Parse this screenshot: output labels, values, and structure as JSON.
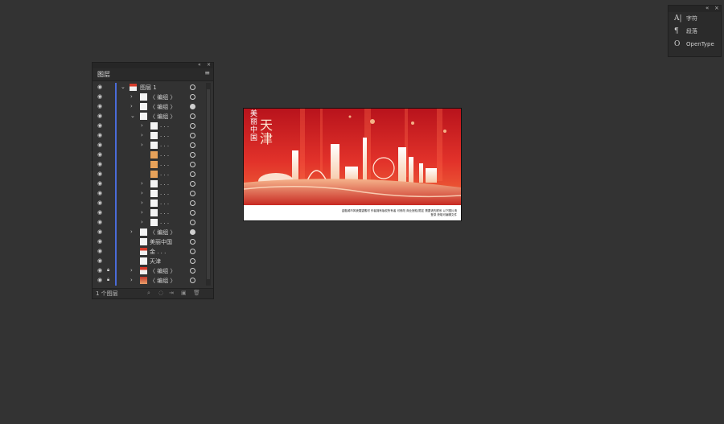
{
  "char_panel": {
    "items": [
      {
        "icon": "A|",
        "label": "字符"
      },
      {
        "icon": "¶",
        "label": "段落"
      },
      {
        "icon": "O",
        "label": "OpenType"
      }
    ]
  },
  "layers_panel": {
    "tab": "图层",
    "footer": {
      "count": "1 个图层"
    },
    "rows": [
      {
        "name": "图层 1"
      },
      {
        "name": "〈 编组 〉"
      },
      {
        "name": "〈 编组 〉"
      },
      {
        "name": "〈 编组 〉"
      },
      {
        "name": ". . ."
      },
      {
        "name": ". . ."
      },
      {
        "name": ". . ."
      },
      {
        "name": ". . ."
      },
      {
        "name": ". . ."
      },
      {
        "name": ". . ."
      },
      {
        "name": ". . ."
      },
      {
        "name": ". . ."
      },
      {
        "name": ". . ."
      },
      {
        "name": ". . ."
      },
      {
        "name": ". . ."
      },
      {
        "name": "〈 编组 〉"
      },
      {
        "name": "美丽中国"
      },
      {
        "name": "金 . . ."
      },
      {
        "name": "天津"
      },
      {
        "name": "〈 编组 〉"
      },
      {
        "name": "〈 编组 〉"
      }
    ]
  },
  "artboard": {
    "vertical_title": "美丽中国",
    "city_title": "天津",
    "caption": "金融城市风貌展望素材 作者拥有版权所有者 可修改 商业授权/限定 需要请先联系 以下图片请登录 获取可编辑文件"
  }
}
